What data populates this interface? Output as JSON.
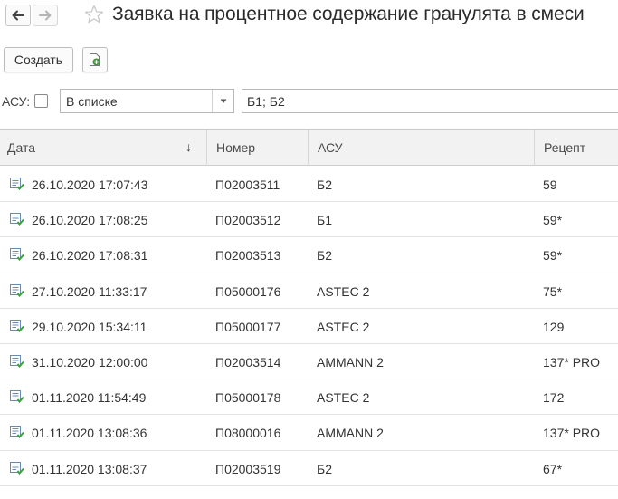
{
  "header": {
    "title": "Заявка на процентное содержание гранулята в смеси"
  },
  "toolbar": {
    "create_label": "Создать"
  },
  "filter": {
    "asu_label": "АСУ:",
    "mode_value": "В списке",
    "values": "Б1; Б2"
  },
  "table": {
    "columns": [
      "Дата",
      "Номер",
      "АСУ",
      "Рецепт"
    ],
    "rows": [
      {
        "date": "26.10.2020 17:07:43",
        "number": "П02003511",
        "asu": "Б2",
        "recipe": "59"
      },
      {
        "date": "26.10.2020 17:08:25",
        "number": "П02003512",
        "asu": "Б1",
        "recipe": "59*"
      },
      {
        "date": "26.10.2020 17:08:31",
        "number": "П02003513",
        "asu": "Б2",
        "recipe": "59*"
      },
      {
        "date": "27.10.2020 11:33:17",
        "number": "П05000176",
        "asu": "ASTEC 2",
        "recipe": "75*"
      },
      {
        "date": "29.10.2020 15:34:11",
        "number": "П05000177",
        "asu": "ASTEC 2",
        "recipe": "129"
      },
      {
        "date": "31.10.2020 12:00:00",
        "number": "П02003514",
        "asu": "AMMANN 2",
        "recipe": "137* PRO"
      },
      {
        "date": "01.11.2020 11:54:49",
        "number": "П05000178",
        "asu": "ASTEC 2",
        "recipe": "172"
      },
      {
        "date": "01.11.2020 13:08:36",
        "number": "П08000016",
        "asu": "AMMANN 2",
        "recipe": "137* PRO"
      },
      {
        "date": "01.11.2020 13:08:37",
        "number": "П02003519",
        "asu": "Б2",
        "recipe": "67*"
      }
    ]
  }
}
